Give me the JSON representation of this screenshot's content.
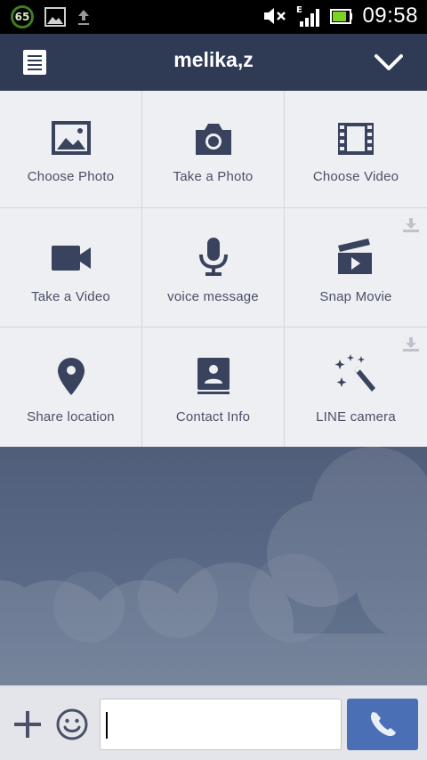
{
  "status_bar": {
    "battery_badge": "65",
    "time": "09:58"
  },
  "header": {
    "title": "melika,z"
  },
  "attachments": [
    {
      "label": "Choose Photo"
    },
    {
      "label": "Take a Photo"
    },
    {
      "label": "Choose Video"
    },
    {
      "label": "Take a Video"
    },
    {
      "label": "voice message"
    },
    {
      "label": "Snap Movie"
    },
    {
      "label": "Share location"
    },
    {
      "label": "Contact Info"
    },
    {
      "label": "LINE camera"
    }
  ],
  "input": {
    "value": "",
    "placeholder": ""
  },
  "colors": {
    "header_bg": "#2f3a55",
    "icon": "#39435d",
    "grid_bg": "#eeeff3",
    "call_button": "#4a6fb5"
  }
}
